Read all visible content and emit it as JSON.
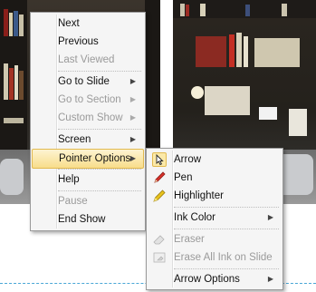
{
  "context_menu": {
    "items": [
      {
        "label": "Next",
        "mnemonic": "N"
      },
      {
        "label": "Previous",
        "mnemonic": "P"
      },
      {
        "label": "Last Viewed"
      },
      {
        "label": "Go to Slide",
        "mnemonic": "G"
      },
      {
        "label": "Go to Section"
      },
      {
        "label": "Custom Show"
      },
      {
        "label": "Screen",
        "mnemonic": "c"
      },
      {
        "label": "Pointer Options",
        "mnemonic": "o"
      },
      {
        "label": "Help",
        "mnemonic": "H"
      },
      {
        "label": "Pause"
      },
      {
        "label": "End Show",
        "mnemonic": "E"
      }
    ]
  },
  "pointer_submenu": {
    "items": [
      {
        "label": "Arrow",
        "icon": "arrow-cursor-icon"
      },
      {
        "label": "Pen",
        "icon": "pen-icon"
      },
      {
        "label": "Highlighter",
        "icon": "highlighter-icon"
      },
      {
        "label": "Ink Color"
      },
      {
        "label": "Eraser",
        "icon": "eraser-icon"
      },
      {
        "label": "Erase All Ink on Slide",
        "icon": "erase-all-icon"
      },
      {
        "label": "Arrow Options"
      }
    ]
  },
  "colors": {
    "highlight_top": "#fdf4d2",
    "highlight_bottom": "#f8dd8b",
    "highlight_border": "#e1b94f",
    "menu_bg": "#f5f5f5",
    "disabled_text": "#9a9a9a",
    "pen_red": "#d8322a",
    "highlighter_yellow": "#e8c21c",
    "slide_dash": "#4aa7d6"
  }
}
